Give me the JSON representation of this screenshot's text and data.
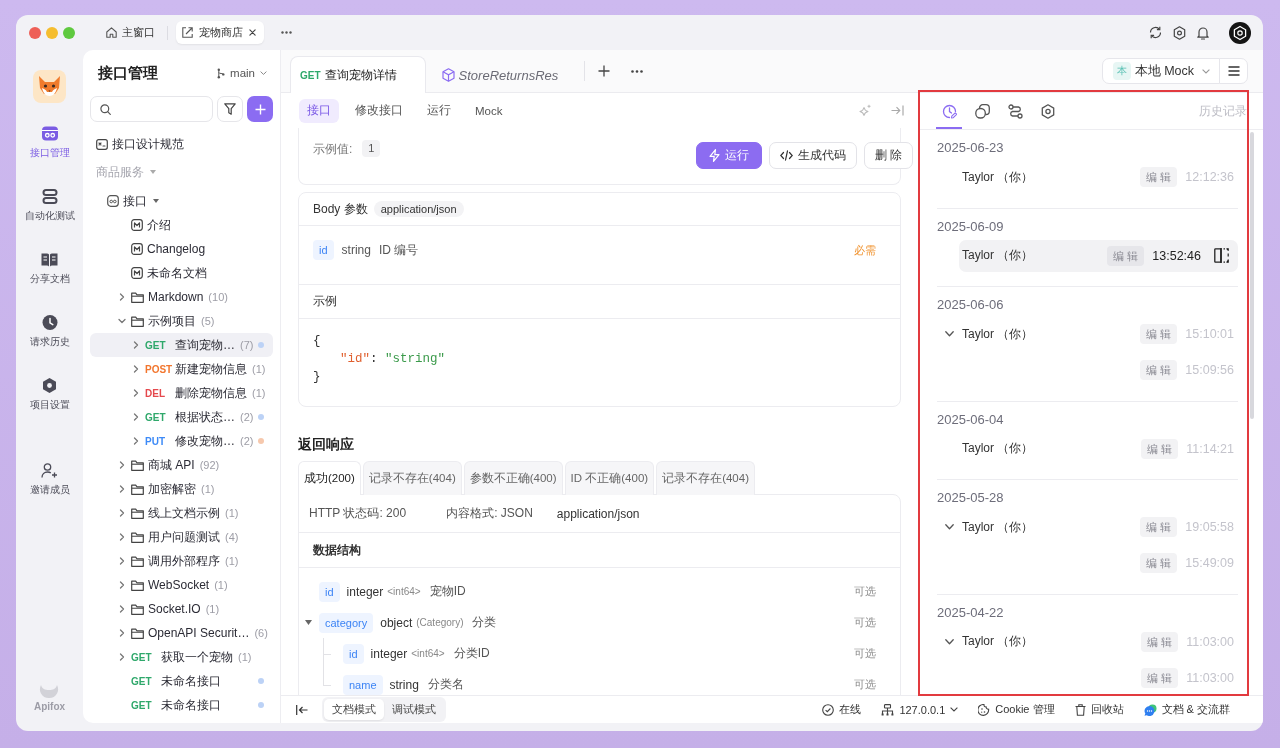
{
  "window": {
    "tabs": [
      {
        "kind": "home",
        "label": "主窗口",
        "selected": false
      },
      {
        "kind": "project",
        "label": "宠物商店",
        "selected": true
      }
    ]
  },
  "nav": {
    "items": [
      {
        "kind": "api",
        "label": "接口管理",
        "selected": true
      },
      {
        "kind": "tests",
        "label": "自动化测试",
        "selected": false
      },
      {
        "kind": "docs",
        "label": "分享文档",
        "selected": false
      },
      {
        "kind": "history",
        "label": "请求历史",
        "selected": false
      },
      {
        "kind": "settings",
        "label": "项目设置",
        "selected": false
      },
      {
        "kind": "invite",
        "label": "邀请成员",
        "selected": false
      }
    ],
    "brand": "Apifox"
  },
  "sidebar": {
    "title": "接口管理",
    "branch": "main",
    "tree": [
      {
        "kind": "guide",
        "label": "接口设计规范",
        "selected": false
      },
      {
        "kind": "group",
        "label": "商品服务",
        "expanded": true,
        "selected": false,
        "children": [
          {
            "kind": "root",
            "label": "接口",
            "expanded": true,
            "selected": false,
            "children": [
              {
                "kind": "doc",
                "label": "介绍",
                "selected": false
              },
              {
                "kind": "doc",
                "label": "Changelog",
                "selected": false
              },
              {
                "kind": "doc",
                "label": "未命名文档",
                "selected": false
              },
              {
                "kind": "folder",
                "label": "Markdown",
                "count": "(10)",
                "expanded": false,
                "selected": false
              },
              {
                "kind": "folder",
                "label": "示例项目",
                "count": "(5)",
                "expanded": true,
                "selected": false,
                "children": [
                  {
                    "kind": "endpoint",
                    "method": {
                      "text": "GET",
                      "color": "#2fa86b"
                    },
                    "label": "查询宠物…",
                    "count": "(7)",
                    "color": "#bcd2f6",
                    "expanded": false,
                    "selected": true
                  },
                  {
                    "kind": "endpoint",
                    "method": {
                      "text": "POST",
                      "color": "#f2762e"
                    },
                    "label": "新建宠物信息",
                    "count": "(1)",
                    "expanded": false,
                    "selected": false
                  },
                  {
                    "kind": "endpoint",
                    "method": {
                      "text": "DEL",
                      "color": "#e5484d"
                    },
                    "label": "删除宠物信息",
                    "count": "(1)",
                    "expanded": false,
                    "selected": false
                  },
                  {
                    "kind": "endpoint",
                    "method": {
                      "text": "GET",
                      "color": "#2fa86b"
                    },
                    "label": "根据状态…",
                    "count": "(2)",
                    "color": "#bcd2f6",
                    "expanded": false,
                    "selected": false
                  },
                  {
                    "kind": "endpoint",
                    "method": {
                      "text": "PUT",
                      "color": "#3d8af7"
                    },
                    "label": "修改宠物…",
                    "count": "(2)",
                    "color": "#f6c8ad",
                    "expanded": false,
                    "selected": false
                  }
                ]
              },
              {
                "kind": "folder",
                "label": "商城 API",
                "count": "(92)",
                "expanded": false,
                "selected": false
              },
              {
                "kind": "folder",
                "label": "加密解密",
                "count": "(1)",
                "expanded": false,
                "selected": false
              },
              {
                "kind": "folder",
                "label": "线上文档示例",
                "count": "(1)",
                "expanded": false,
                "selected": false
              },
              {
                "kind": "folder",
                "label": "用户问题测试",
                "count": "(4)",
                "expanded": false,
                "selected": false
              },
              {
                "kind": "folder",
                "label": "调用外部程序",
                "count": "(1)",
                "expanded": false,
                "selected": false
              },
              {
                "kind": "folder",
                "label": "WebSocket",
                "count": "(1)",
                "expanded": false,
                "selected": false
              },
              {
                "kind": "folder",
                "label": "Socket.IO",
                "count": "(1)",
                "expanded": false,
                "selected": false
              },
              {
                "kind": "folder",
                "label": "OpenAPI Securit…",
                "count": "(6)",
                "expanded": false,
                "selected": false
              },
              {
                "kind": "endpoint",
                "method": {
                  "text": "GET",
                  "color": "#2fa86b"
                },
                "label": "获取一个宠物",
                "count": "(1)",
                "expanded": false,
                "selected": false
              },
              {
                "kind": "endpoint",
                "method": {
                  "text": "GET",
                  "color": "#2fa86b"
                },
                "label": "未命名接口",
                "color": "#bcd2f6",
                "selected": false
              },
              {
                "kind": "endpoint",
                "method": {
                  "text": "GET",
                  "color": "#2fa86b"
                },
                "label": "未命名接口",
                "color": "#bcd2f6",
                "selected": false
              }
            ]
          }
        ]
      }
    ]
  },
  "doc_tabs": [
    {
      "kind": "request",
      "method": {
        "text": "GET",
        "color": "#2fa86b"
      },
      "title": "查询宠物详情",
      "selected": true
    },
    {
      "kind": "schema",
      "title": "StoreReturnsRes",
      "selected": false
    }
  ],
  "environment": {
    "badge": "本",
    "label": "本地 Mock"
  },
  "view_tabs": [
    {
      "label": "接口",
      "selected": true
    },
    {
      "label": "修改接口",
      "selected": false
    },
    {
      "label": "运行",
      "selected": false
    },
    {
      "label": "Mock",
      "selected": false
    }
  ],
  "path_params": {
    "example_label": "示例值:",
    "example_value": "1"
  },
  "actions": [
    {
      "kind": "run",
      "label": "运行"
    },
    {
      "kind": "code",
      "label": "生成代码"
    },
    {
      "kind": "delete",
      "label": "删 除"
    }
  ],
  "body": {
    "title": "Body 参数",
    "content_type": "application/json",
    "params": [
      {
        "name": "id",
        "type": "string",
        "description": "ID 编号",
        "required": "必需"
      }
    ],
    "example": {
      "title": "示例",
      "code": {
        "open": "{",
        "fields": [
          {
            "key": "\"id\"",
            "separator": ": ",
            "value": "\"string\""
          }
        ],
        "close": "}"
      }
    }
  },
  "response": {
    "title": "返回响应",
    "tabs": [
      {
        "label": "成功(200)",
        "selected": true
      },
      {
        "label": "记录不存在(404)",
        "selected": false
      },
      {
        "label": "参数不正确(400)",
        "selected": false
      },
      {
        "label": "ID 不正确(400)",
        "selected": false
      },
      {
        "label": "记录不存在(404)",
        "selected": false
      }
    ],
    "info": [
      "HTTP 状态码: 200",
      "内容格式: JSON",
      "application/json"
    ],
    "schema": {
      "title": "数据结构",
      "fields": [
        {
          "name": "id",
          "type": "integer",
          "format": "<int64>",
          "description": "宠物ID",
          "optional": "可选"
        },
        {
          "name": "category",
          "type": "object",
          "format": "(Category)",
          "description": "分类",
          "optional": "可选",
          "expanded": true,
          "children": [
            {
              "name": "id",
              "type": "integer",
              "format": "<int64>",
              "description": "分类ID",
              "optional": "可选"
            },
            {
              "name": "name",
              "type": "string",
              "description": "分类名",
              "optional": "可选"
            }
          ]
        }
      ]
    }
  },
  "history": {
    "tabs": [
      {
        "kind": "history",
        "selected": true
      },
      {
        "kind": "components",
        "selected": false
      },
      {
        "kind": "flow",
        "selected": false
      },
      {
        "kind": "settings",
        "selected": false
      }
    ],
    "title": "历史记录",
    "groups": [
      {
        "date": "2025-06-23",
        "author": "Taylor （你）",
        "entries": [
          {
            "action": "编 辑",
            "time": "12:12:36",
            "selected": false
          }
        ]
      },
      {
        "date": "2025-06-09",
        "author": "Taylor （你）",
        "entries": [
          {
            "action": "编 辑",
            "time": "13:52:46",
            "selected": true
          }
        ]
      },
      {
        "date": "2025-06-06",
        "author": "Taylor （你）",
        "expanded": true,
        "entries": [
          {
            "action": "编 辑",
            "time": "15:10:01",
            "selected": false
          },
          {
            "action": "编 辑",
            "time": "15:09:56",
            "selected": false
          }
        ]
      },
      {
        "date": "2025-06-04",
        "author": "Taylor （你）",
        "entries": [
          {
            "action": "编 辑",
            "time": "11:14:21",
            "selected": false
          }
        ]
      },
      {
        "date": "2025-05-28",
        "author": "Taylor （你）",
        "expanded": true,
        "entries": [
          {
            "action": "编 辑",
            "time": "19:05:58",
            "selected": false
          },
          {
            "action": "编 辑",
            "time": "15:49:09",
            "selected": false
          }
        ]
      },
      {
        "date": "2025-04-22",
        "author": "Taylor （你）",
        "expanded": true,
        "entries": [
          {
            "action": "编 辑",
            "time": "11:03:00",
            "selected": false
          },
          {
            "action": "编 辑",
            "time": "11:03:00",
            "selected": false
          }
        ]
      }
    ]
  },
  "status_bar": {
    "modes": [
      {
        "label": "文档模式",
        "selected": true
      },
      {
        "label": "调试模式",
        "selected": false
      }
    ],
    "items": [
      {
        "kind": "online",
        "label": "在线"
      },
      {
        "kind": "server",
        "label": "127.0.0.1"
      },
      {
        "kind": "cookie",
        "label": "Cookie 管理"
      },
      {
        "kind": "trash",
        "label": "回收站"
      },
      {
        "kind": "chat",
        "label": "文档 & 交流群"
      }
    ]
  }
}
